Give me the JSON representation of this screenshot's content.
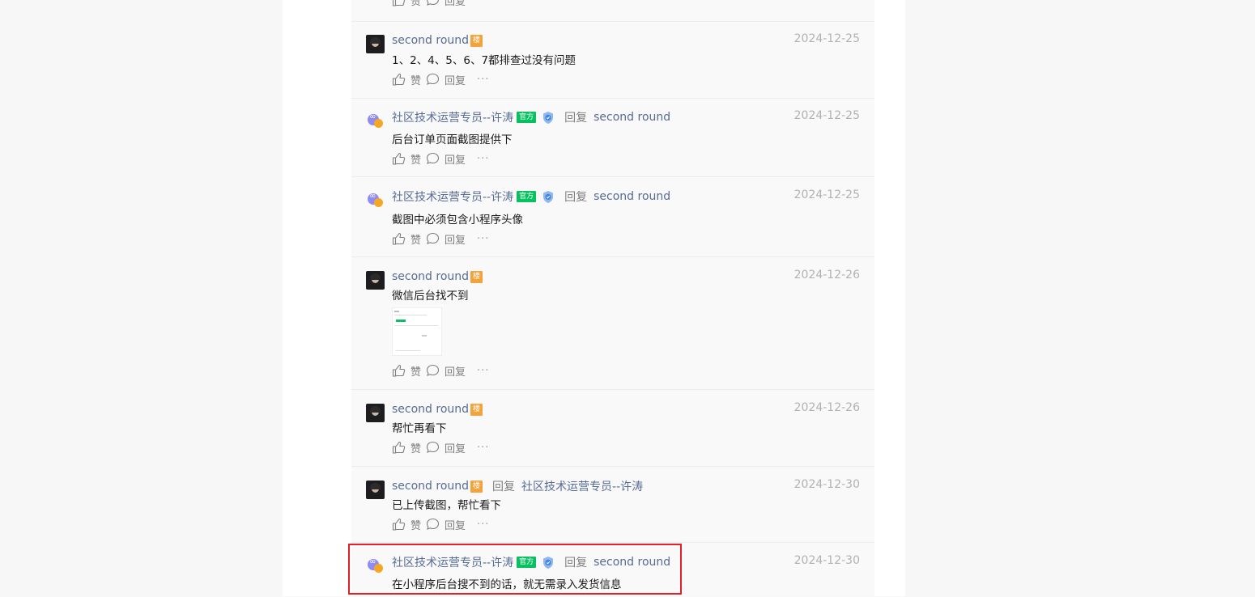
{
  "colors": {
    "link_name": "#576b95",
    "date": "#b2b2b2",
    "floor_badge": "#f3a33b",
    "official_badge": "#07c160",
    "highlight_border": "#e0202a"
  },
  "top_actions": {
    "like": "赞",
    "reply": "回复",
    "more": "···"
  },
  "replies": [
    {
      "author": "second round",
      "author_badge": "楼",
      "reply_word": "",
      "reply_target": "",
      "date": "2024-12-25",
      "content": "1、2、4、5、6、7都排查过没有问题",
      "like": "赞",
      "reply": "回复",
      "more": "···"
    },
    {
      "author": "社区技术运营专员--许涛",
      "author_badge": "官方",
      "reply_word": "回复",
      "reply_target": "second round",
      "date": "2024-12-25",
      "content": "后台订单页面截图提供下",
      "like": "赞",
      "reply": "回复",
      "more": "···"
    },
    {
      "author": "社区技术运营专员--许涛",
      "author_badge": "官方",
      "reply_word": "回复",
      "reply_target": "second round",
      "date": "2024-12-25",
      "content": "截图中必须包含小程序头像",
      "like": "赞",
      "reply": "回复",
      "more": "···"
    },
    {
      "author": "second round",
      "author_badge": "楼",
      "reply_word": "",
      "reply_target": "",
      "date": "2024-12-26",
      "content": "微信后台找不到",
      "like": "赞",
      "reply": "回复",
      "more": "···"
    },
    {
      "author": "second round",
      "author_badge": "楼",
      "reply_word": "",
      "reply_target": "",
      "date": "2024-12-26",
      "content": "帮忙再看下",
      "like": "赞",
      "reply": "回复",
      "more": "···"
    },
    {
      "author": "second round",
      "author_badge": "楼",
      "reply_word": "回复",
      "reply_target": "社区技术运营专员--许涛",
      "date": "2024-12-30",
      "content": "已上传截图，帮忙看下",
      "like": "赞",
      "reply": "回复",
      "more": "···"
    },
    {
      "author": "社区技术运营专员--许涛",
      "author_badge": "官方",
      "reply_word": "回复",
      "reply_target": "second round",
      "date": "2024-12-30",
      "content": "在小程序后台搜不到的话，就无需录入发货信息"
    }
  ]
}
